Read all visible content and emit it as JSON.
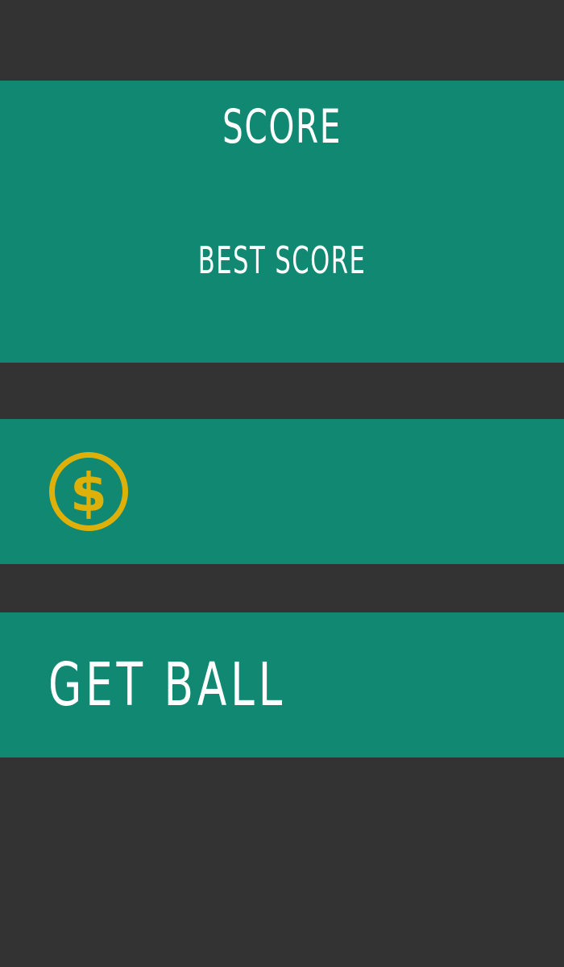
{
  "score": {
    "label": "SCORE",
    "best_label": "BEST SCORE"
  },
  "coins": {
    "icon": "dollar-coin-icon"
  },
  "get_ball": {
    "label": "GET BALL"
  },
  "colors": {
    "background": "#333333",
    "panel": "#108872",
    "text": "#ffffff",
    "coin": "#DDB109"
  }
}
